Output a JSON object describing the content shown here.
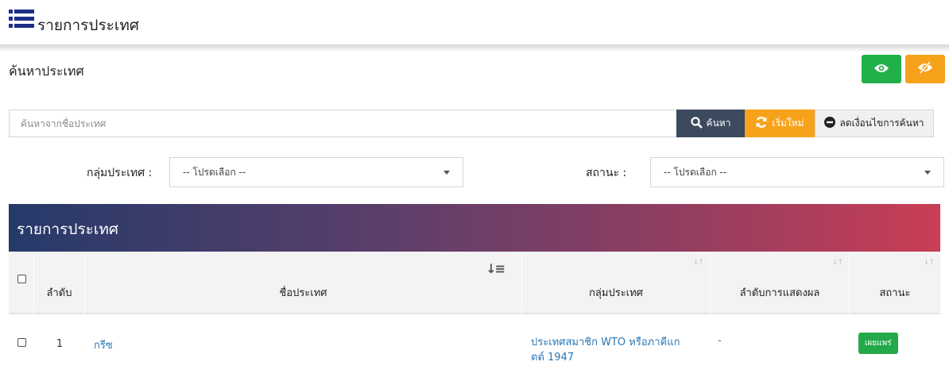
{
  "header": {
    "title": "รายการประเทศ",
    "icon": "list-icon"
  },
  "search": {
    "title": "ค้นหาประเทศ",
    "placeholder": "ค้นหาจากชื่อประเทศ",
    "search_button": "ค้นหา",
    "reset_button": "เริ่มใหม่",
    "reduce_button": "ลดเงื่อนไขการค้นหา"
  },
  "filters": {
    "group_label": "กลุ่มประเทศ :",
    "group_value": "-- โปรดเลือก --",
    "status_label": "สถานะ :",
    "status_value": "-- โปรดเลือก --"
  },
  "panel": {
    "title": "รายการประเทศ"
  },
  "table": {
    "columns": {
      "order": "ลำดับ",
      "name": "ชื่อประเทศ",
      "group": "กลุ่มประเทศ",
      "display_order": "ลำดับการแสดงผล",
      "status": "สถานะ"
    },
    "rows": [
      {
        "order": "1",
        "name": "กรีซ",
        "group_line1": "ประเทศสมาชิก WTO หรือภาคีแก",
        "group_line2": "ตต์ 1947",
        "display_order": "-",
        "status": "เผยแพร่"
      }
    ]
  },
  "colors": {
    "show_button": "#22b04b",
    "hide_button": "#f7a21b",
    "search_button": "#3b4a5e",
    "reset_button": "#f7a21b",
    "badge": "#24a94a",
    "link": "#2a77b5",
    "panel_gradient_start": "#253a6a",
    "panel_gradient_end": "#c93e55"
  }
}
